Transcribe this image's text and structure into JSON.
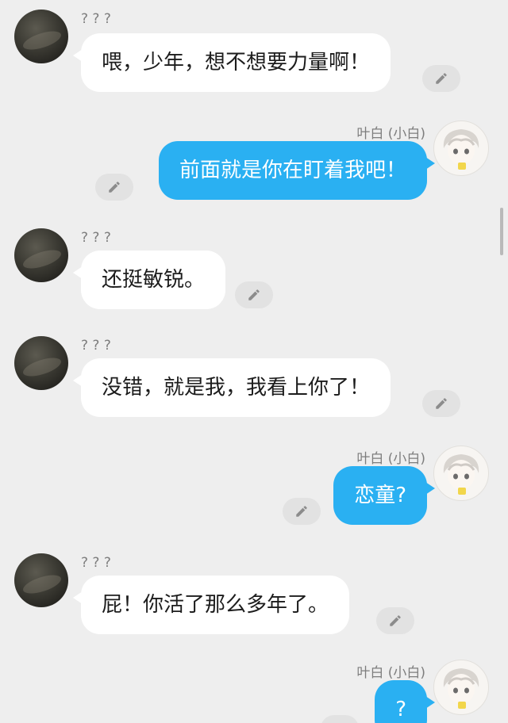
{
  "messages": [
    {
      "side": "left",
      "name": "? ? ?",
      "text": "喂，少年，想不想要力量啊！"
    },
    {
      "side": "right",
      "name": "叶白 (小白)",
      "text": "前面就是你在盯着我吧！"
    },
    {
      "side": "left",
      "name": "? ? ?",
      "text": "还挺敏锐。"
    },
    {
      "side": "left",
      "name": "? ? ?",
      "text": "没错，就是我，我看上你了！"
    },
    {
      "side": "right",
      "name": "叶白 (小白)",
      "text": "恋童?"
    },
    {
      "side": "left",
      "name": "? ? ?",
      "text": "屁！你活了那么多年了。"
    },
    {
      "side": "right",
      "name": "叶白 (小白)",
      "text": "?"
    }
  ],
  "colors": {
    "background": "#eeeeee",
    "bubble_left": "#ffffff",
    "bubble_right": "#2ab0f2",
    "name_text": "#7d7d7d"
  },
  "icons": {
    "edit": "pencil-icon",
    "avatar_left": "dark-photo-avatar",
    "avatar_right": "anime-character-avatar"
  }
}
